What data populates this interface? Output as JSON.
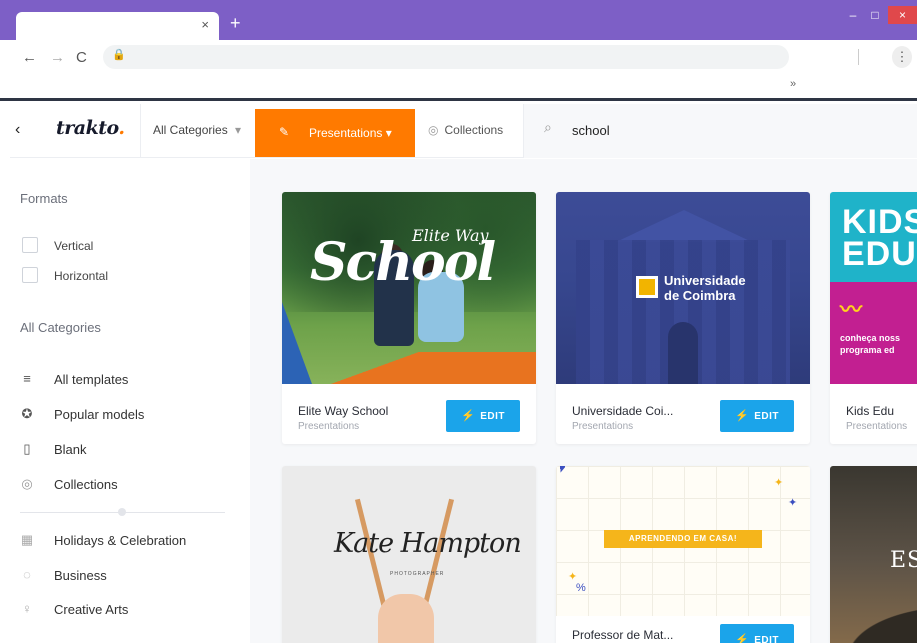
{
  "browser": {
    "tab_close_glyph": "×",
    "new_tab_glyph": "+",
    "win_min_glyph": "–",
    "win_max_glyph": "□",
    "win_close_glyph": "×",
    "back_glyph": "←",
    "forward_glyph": "→",
    "reload_glyph": "C",
    "lock_glyph": "🔒",
    "menu_glyph": "⋮",
    "bookmarks_more": "»",
    "frame_color": "#7d5fc6"
  },
  "header": {
    "back_glyph": "‹",
    "logo_text": "trakto",
    "logo_dot": ".",
    "category_dropdown": "All Categories",
    "dropdown_caret": "▾",
    "presentations_label": "Presentations",
    "presentations_icon": "pencil-icon",
    "collections_label": "Collections",
    "search_value": "school",
    "search_glyph": "⌕",
    "accent_color": "#ff7a00"
  },
  "sidebar": {
    "formats_title": "Formats",
    "formats": [
      {
        "label": "Vertical",
        "checked": false
      },
      {
        "label": "Horizontal",
        "checked": false
      }
    ],
    "categories_title": "All Categories",
    "items": [
      {
        "label": "All templates",
        "icon": "list-icon",
        "glyph": "≡"
      },
      {
        "label": "Popular models",
        "icon": "award-icon",
        "glyph": "✪"
      },
      {
        "label": "Blank",
        "icon": "blank-doc-icon",
        "glyph": "▯"
      },
      {
        "label": "Collections",
        "icon": "collections-icon",
        "glyph": "◎"
      }
    ],
    "more_items": [
      {
        "label": "Holidays & Celebration",
        "icon": "calendar-icon",
        "glyph": "▦"
      },
      {
        "label": "Business",
        "icon": "business-icon",
        "glyph": "◌"
      },
      {
        "label": "Creative Arts",
        "icon": "arts-icon",
        "glyph": "♀"
      }
    ]
  },
  "templates": [
    {
      "title": "Elite Way School",
      "category": "Presentations",
      "edit_label": "EDIT",
      "thumb_text": "School",
      "thumb_subtext": "Elite Way"
    },
    {
      "title": "Universidade Coi...",
      "category": "Presentations",
      "edit_label": "EDIT",
      "thumb_text": "Universidade",
      "thumb_subtext": "de Coimbra"
    },
    {
      "title": "Kids Edu",
      "category": "Presentations",
      "thumb_text": "KIDS",
      "thumb_subtext": "EDU",
      "thumb_caption_1": "conheça noss",
      "thumb_caption_2": "programa ed"
    },
    {
      "title": "",
      "category": "",
      "thumb_text": "Kate Hampton",
      "thumb_subtext": "PHOTOGRAPHER"
    },
    {
      "title": "Professor de Mat...",
      "category": "",
      "edit_label": "EDIT",
      "thumb_text": "APRENDENDO EM CASA!"
    },
    {
      "title": "",
      "category": "",
      "thumb_text": "ES"
    }
  ],
  "edit_icon_glyph": "⚡",
  "edit_color": "#1ba4ea"
}
